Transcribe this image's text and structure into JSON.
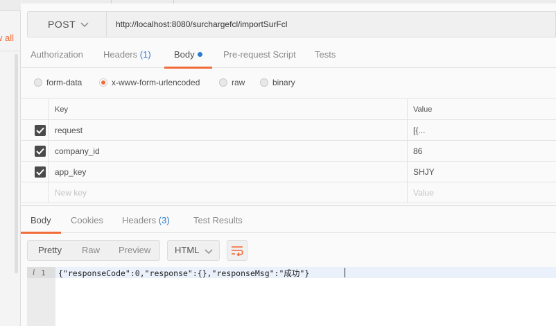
{
  "sidebar": {
    "link_label": "w all"
  },
  "request": {
    "method": "POST",
    "url": "http://localhost:8080/surchargefcl/importSurFcl"
  },
  "request_tabs": [
    {
      "label": "Authorization"
    },
    {
      "label": "Headers",
      "count": "(1)"
    },
    {
      "label": "Body",
      "active": true
    },
    {
      "label": "Pre-request Script"
    },
    {
      "label": "Tests"
    }
  ],
  "body_types": [
    {
      "label": "form-data",
      "selected": false
    },
    {
      "label": "x-www-form-urlencoded",
      "selected": true
    },
    {
      "label": "raw",
      "selected": false
    },
    {
      "label": "binary",
      "selected": false
    }
  ],
  "params_table": {
    "columns": [
      "Key",
      "Value"
    ],
    "rows": [
      {
        "key": "request",
        "value": "[{...",
        "checked": true
      },
      {
        "key": "company_id",
        "value": "86",
        "checked": true
      },
      {
        "key": "app_key",
        "value": "SHJY",
        "checked": true
      }
    ],
    "new_key_placeholder": "New key",
    "new_value_placeholder": "Value"
  },
  "response_tabs": [
    {
      "label": "Body",
      "active": true
    },
    {
      "label": "Cookies"
    },
    {
      "label": "Headers",
      "count": "(3)"
    },
    {
      "label": "Test Results"
    }
  ],
  "response_toolbar": {
    "formats": [
      "Pretty",
      "Raw",
      "Preview"
    ],
    "active_format": "Pretty",
    "language": "HTML"
  },
  "response_body": {
    "line_number": "1",
    "info_marker": "i",
    "code": "{\"responseCode\":0,\"response\":{},\"responseMsg\":\"成功\"}"
  },
  "colors": {
    "accent": "#f26b3a",
    "link_blue": "#2d7ad1",
    "checkbox": "#4a4a4a"
  }
}
